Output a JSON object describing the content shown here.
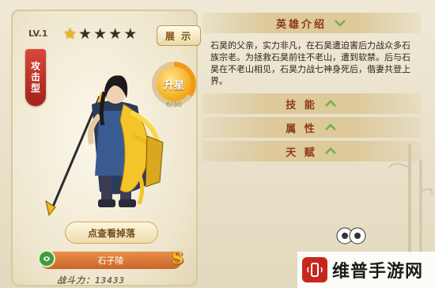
{
  "hero": {
    "level": "LV.1",
    "stars": [
      true,
      false,
      false,
      false,
      false
    ],
    "type": "攻击型",
    "show_label": "展 示",
    "upgrade_label": "升星",
    "upgrade_progress": "6/30",
    "drop_label": "点查看掉落",
    "faction_icon": "faction-badge",
    "name": "石子陵",
    "rank": "S",
    "power_label": "战斗力：13433"
  },
  "info": {
    "intro_label": "英雄介绍",
    "intro_text": "石昊的父亲，实力非凡，在石昊遭迫害后力战众多石族宗老。为拯救石昊前往不老山，遭到软禁。后与石昊在不老山相见，石昊力战七神身死后，偕妻共登上界。",
    "skills_label": "技 能",
    "attrs_label": "属 性",
    "talent_label": "天 赋"
  },
  "watermark": {
    "brand": "维普手游网"
  },
  "colors": {
    "accent": "#f2b21a",
    "header_text": "#8e3a16",
    "type_tag": "#c4342a",
    "chevron": "#6fb14a"
  }
}
